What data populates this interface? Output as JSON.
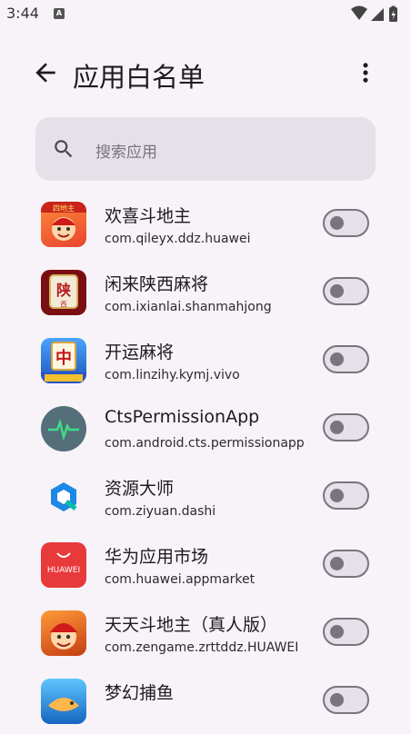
{
  "status_bar": {
    "time": "3:44",
    "notification_icon": "a-badge-icon",
    "icons": [
      "wifi-icon",
      "signal-icon",
      "battery-icon"
    ]
  },
  "app_bar": {
    "title": "应用白名单",
    "back_icon": "arrow-back-icon",
    "menu_icon": "more-vert-icon"
  },
  "search": {
    "placeholder": "搜索应用",
    "icon": "search-icon"
  },
  "apps": [
    {
      "name": "欢喜斗地主",
      "package": "com.qileyx.ddz.huawei",
      "enabled": false,
      "icon_color": "#e8442e"
    },
    {
      "name": "闲来陕西麻将",
      "package": "com.ixianlai.shanmahjong",
      "enabled": false,
      "icon_color": "#b8191f"
    },
    {
      "name": "开运麻将",
      "package": "com.linzihy.kymj.vivo",
      "enabled": false,
      "icon_color": "#2a6fd6"
    },
    {
      "name": "CtsPermissionApp",
      "package": "com.android.cts.permissionapp",
      "enabled": false,
      "icon_color": "#546e7a"
    },
    {
      "name": "资源大师",
      "package": "com.ziyuan.dashi",
      "enabled": false,
      "icon_color": "#1e88e5"
    },
    {
      "name": "华为应用市场",
      "package": "com.huawei.appmarket",
      "enabled": false,
      "icon_color": "#e8393b",
      "icon_text": "HUAWEI"
    },
    {
      "name": "天天斗地主（真人版）",
      "package": "com.zengame.zrttddz.HUAWEI",
      "enabled": false,
      "icon_color": "#e06a1b"
    },
    {
      "name": "梦幻捕鱼",
      "package": "",
      "enabled": false,
      "icon_color": "#1e90d8"
    }
  ]
}
